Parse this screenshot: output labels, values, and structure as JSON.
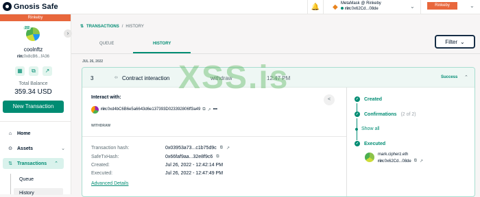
{
  "app": {
    "name": "Gnosis Safe"
  },
  "header": {
    "wallet_name": "MetaMask @ Rinkeby",
    "wallet_prefix": "rin:",
    "wallet_addr": "0x62Cd...08de",
    "network": "Rinkeby"
  },
  "sidebar": {
    "banner": "Rinkeby",
    "threshold": "2/2",
    "safe_name": "coolnftz",
    "safe_prefix": "rin:",
    "safe_addr": "0x8cB6...fA36",
    "balance_label": "Total Balance",
    "balance_value": "359.34 USD",
    "new_tx_label": "New Transaction",
    "nav": {
      "home": "Home",
      "assets": "Assets",
      "transactions": "Transactions",
      "queue": "Queue",
      "history": "History"
    }
  },
  "main": {
    "breadcrumb": {
      "section": "TRANSACTIONS",
      "sep": "/",
      "page": "HISTORY"
    },
    "tabs": {
      "queue": "QUEUE",
      "history": "HISTORY"
    },
    "filter_label": "Filter",
    "date_label": "JUL 26, 2022"
  },
  "tx": {
    "nonce": "3",
    "type": "Contract interaction",
    "method": "withdraw",
    "time": "12:47 PM",
    "status": "Success",
    "interact_label": "Interact with:",
    "interact_prefix": "rin:",
    "interact_addr": "0xd4bC6B6e5a6643d6e137393D023392806ff3a49",
    "method_tag": "WITHDRAW",
    "details": [
      {
        "k": "Transaction hash:",
        "v": "0x03953a73...c1b75d9c"
      },
      {
        "k": "SafeTxHash:",
        "v": "0x66faf9aa...32e8f9c6"
      },
      {
        "k": "Created:",
        "v": "Jul 26, 2022 - 12:42:14 PM"
      },
      {
        "k": "Executed:",
        "v": "Jul 26, 2022 - 12:47:49 PM"
      }
    ],
    "advanced_label": "Advanced Details"
  },
  "steps": {
    "created": "Created",
    "confirmations": "Confirmations",
    "confirmations_count": "(2 of 2)",
    "show_all": "Show all",
    "executed": "Executed",
    "executor_name": "mark.cipherz.eth",
    "executor_prefix": "rin:",
    "executor_addr": "0x62Cd...08de"
  },
  "watermark": "XSS.is",
  "icons": {
    "logo": "gnosis-logo-icon",
    "bell": "bell-icon",
    "fox": "metamask-fox-icon",
    "transactions": "arrows-up-down-icon"
  },
  "colors": {
    "accent": "#008c73",
    "network": "#e8673c",
    "dark": "#001428"
  }
}
